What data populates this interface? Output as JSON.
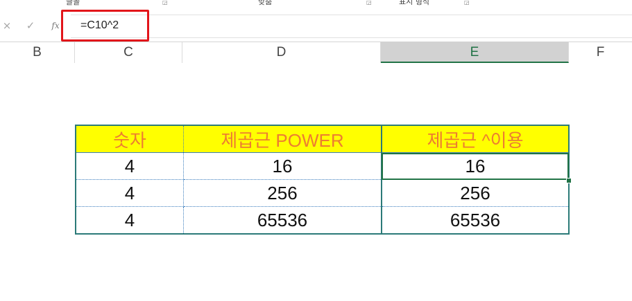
{
  "ribbon": {
    "groups": [
      "글꼴",
      "맞춤",
      "표시 형식"
    ]
  },
  "formula_bar": {
    "cancel_icon": "×",
    "enter_icon": "✓",
    "function_icon": "fx",
    "formula": "=C10^2"
  },
  "columns": [
    {
      "label": "B",
      "selected": false
    },
    {
      "label": "C",
      "selected": false
    },
    {
      "label": "D",
      "selected": false
    },
    {
      "label": "E",
      "selected": true
    },
    {
      "label": "F",
      "selected": false
    }
  ],
  "table": {
    "headers": [
      "숫자",
      "제곱근 POWER",
      "제곱근 ^이용"
    ],
    "rows": [
      [
        "4",
        "16",
        "16"
      ],
      [
        "4",
        "256",
        "256"
      ],
      [
        "4",
        "65536",
        "65536"
      ]
    ]
  },
  "colors": {
    "header_fill": "#ffff00",
    "header_text": "#ed7d31",
    "selection": "#217346",
    "highlight_box": "#e2151a"
  }
}
